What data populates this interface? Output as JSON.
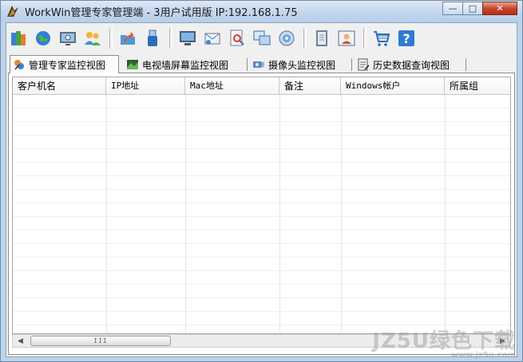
{
  "window": {
    "title": "WorkWin管理专家管理端 - 3用户试用版 IP:192.168.1.75",
    "minimize_glyph": "—",
    "maximize_glyph": "□",
    "close_glyph": "✕"
  },
  "toolbar": {
    "buttons": [
      {
        "icon": "books-icon"
      },
      {
        "icon": "globe-icon"
      },
      {
        "icon": "settings-monitor-icon"
      },
      {
        "icon": "users-icon"
      },
      {
        "icon": "share-icon"
      },
      {
        "icon": "usb-icon"
      },
      {
        "icon": "monitor-icon"
      },
      {
        "icon": "mail-icon"
      },
      {
        "icon": "file-search-icon"
      },
      {
        "icon": "windows-icon"
      },
      {
        "icon": "disc-icon"
      },
      {
        "icon": "notebook-icon"
      },
      {
        "icon": "profile-card-icon"
      },
      {
        "icon": "cart-icon"
      },
      {
        "icon": "help-icon"
      }
    ]
  },
  "tabs": [
    {
      "label": "管理专家监控视图",
      "icon": "manager-view-icon",
      "active": true
    },
    {
      "label": "电视墙屏幕监控视图",
      "icon": "screen-wall-icon",
      "active": false
    },
    {
      "label": "摄像头监控视图",
      "icon": "camera-icon",
      "active": false
    },
    {
      "label": "历史数据查询视图",
      "icon": "history-icon",
      "active": false
    }
  ],
  "table": {
    "columns": [
      "客户机名",
      "IP地址",
      "Mac地址",
      "备注",
      "Windows帐户",
      "所属组"
    ],
    "rows": []
  },
  "scrollbar": {
    "left_arrow": "◀",
    "right_arrow": "▶",
    "grip": "III"
  },
  "watermark": {
    "main": "JZ5U绿色下载",
    "sub": "www.jz5u.com"
  },
  "colors": {
    "title_bar": "#c4d7ee",
    "close_button": "#c8462a",
    "panel_bg": "#f0f0f0"
  }
}
